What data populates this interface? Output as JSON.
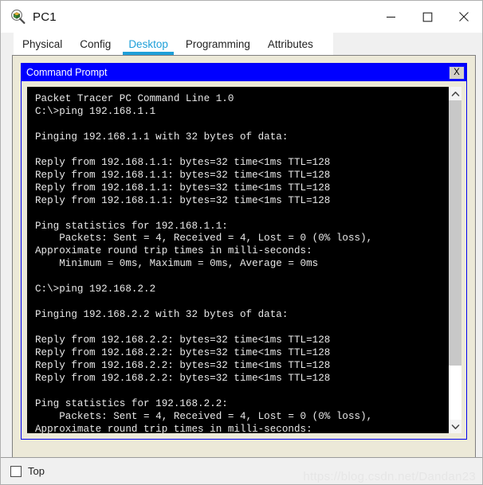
{
  "window": {
    "title": "PC1",
    "icon": "packet-tracer-pc-icon",
    "controls": {
      "minimize": "─",
      "maximize": "□",
      "close": "×"
    }
  },
  "tabs": [
    {
      "label": "Physical",
      "active": false
    },
    {
      "label": "Config",
      "active": false
    },
    {
      "label": "Desktop",
      "active": true
    },
    {
      "label": "Programming",
      "active": false
    },
    {
      "label": "Attributes",
      "active": false
    }
  ],
  "command_prompt": {
    "title": "Command Prompt",
    "close_label": "X",
    "terminal_text": "Packet Tracer PC Command Line 1.0\nC:\\>ping 192.168.1.1\n\nPinging 192.168.1.1 with 32 bytes of data:\n\nReply from 192.168.1.1: bytes=32 time<1ms TTL=128\nReply from 192.168.1.1: bytes=32 time<1ms TTL=128\nReply from 192.168.1.1: bytes=32 time<1ms TTL=128\nReply from 192.168.1.1: bytes=32 time<1ms TTL=128\n\nPing statistics for 192.168.1.1:\n    Packets: Sent = 4, Received = 4, Lost = 0 (0% loss),\nApproximate round trip times in milli-seconds:\n    Minimum = 0ms, Maximum = 0ms, Average = 0ms\n\nC:\\>ping 192.168.2.2\n\nPinging 192.168.2.2 with 32 bytes of data:\n\nReply from 192.168.2.2: bytes=32 time<1ms TTL=128\nReply from 192.168.2.2: bytes=32 time<1ms TTL=128\nReply from 192.168.2.2: bytes=32 time<1ms TTL=128\nReply from 192.168.2.2: bytes=32 time<1ms TTL=128\n\nPing statistics for 192.168.2.2:\n    Packets: Sent = 4, Received = 4, Lost = 0 (0% loss),\nApproximate round trip times in milli-seconds:",
    "scrollbar": {
      "up_arrow": "scroll-up-icon",
      "down_arrow": "scroll-down-icon"
    }
  },
  "bottom_bar": {
    "top_checkbox_label": "Top",
    "top_checkbox_checked": false,
    "watermark": "https://blog.csdn.net/Dandan23"
  },
  "colors": {
    "accent_tab": "#1E9FD8",
    "cmd_title_bar": "#0000FF",
    "panel_beige": "#ECE9D8",
    "terminal_bg": "#000000",
    "terminal_fg": "#E8E8E8"
  }
}
